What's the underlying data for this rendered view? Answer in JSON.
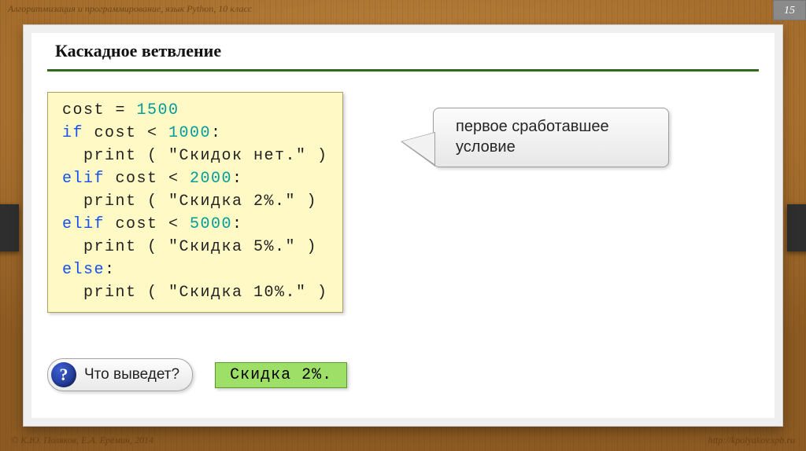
{
  "header": "Алгоритмизация и программирование, язык Python, 10 класс",
  "page_number": "15",
  "title": "Каскадное ветвление",
  "code": {
    "l1a": "cost = ",
    "l1n": "1500",
    "l2a": "if",
    "l2b": " cost < ",
    "l2n": "1000",
    "l2c": ":",
    "l3a": "  print ( \"Скидок нет.\" )",
    "l4a": "elif",
    "l4b": " cost < ",
    "l4n": "2000",
    "l4c": ":",
    "l5a": "  print ( \"Скидка 2%.\" )",
    "l6a": "elif",
    "l6b": " cost < ",
    "l6n": "5000",
    "l6c": ":",
    "l7a": "  print ( \"Скидка 5%.\" )",
    "l8a": "else",
    "l8b": ":",
    "l9a": "  print ( \"Скидка 10%.\" )"
  },
  "callout": {
    "line1": "первое сработавшее",
    "line2": "условие"
  },
  "question": {
    "mark": "?",
    "text": "Что выведет?"
  },
  "answer": "Скидка 2%.",
  "footer": {
    "left": "© К.Ю. Поляков, Е.А. Ерёмин, 2014",
    "right": "http://kpolyakov.spb.ru"
  }
}
